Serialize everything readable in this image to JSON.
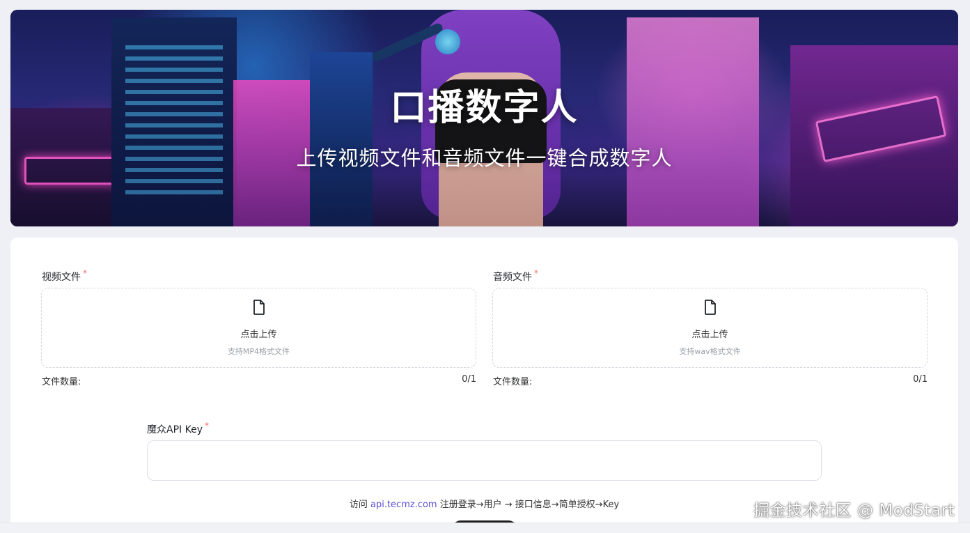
{
  "banner": {
    "title": "口播数字人",
    "subtitle": "上传视频文件和音频文件一键合成数字人"
  },
  "video_upload": {
    "label": "视频文件",
    "required_mark": "*",
    "action_text": "点击上传",
    "hint": "支持MP4格式文件",
    "count_label": "文件数量:",
    "count_value": "0/1",
    "icon": "file-icon"
  },
  "audio_upload": {
    "label": "音频文件",
    "required_mark": "*",
    "action_text": "点击上传",
    "hint": "支持wav格式文件",
    "count_label": "文件数量:",
    "count_value": "0/1",
    "icon": "file-icon"
  },
  "api_key": {
    "label": "魔众API Key",
    "required_mark": "*",
    "value": ""
  },
  "help": {
    "prefix": "访问",
    "link_text": "api.tecmz.com",
    "suffix": "注册登录→用户 → 接口信息→简单授权→Key"
  },
  "watermark": "掘金技术社区 @ ModStart",
  "colors": {
    "required": "#f56c6c",
    "link": "#5a4fd6",
    "page_bg": "#eef0f5"
  }
}
